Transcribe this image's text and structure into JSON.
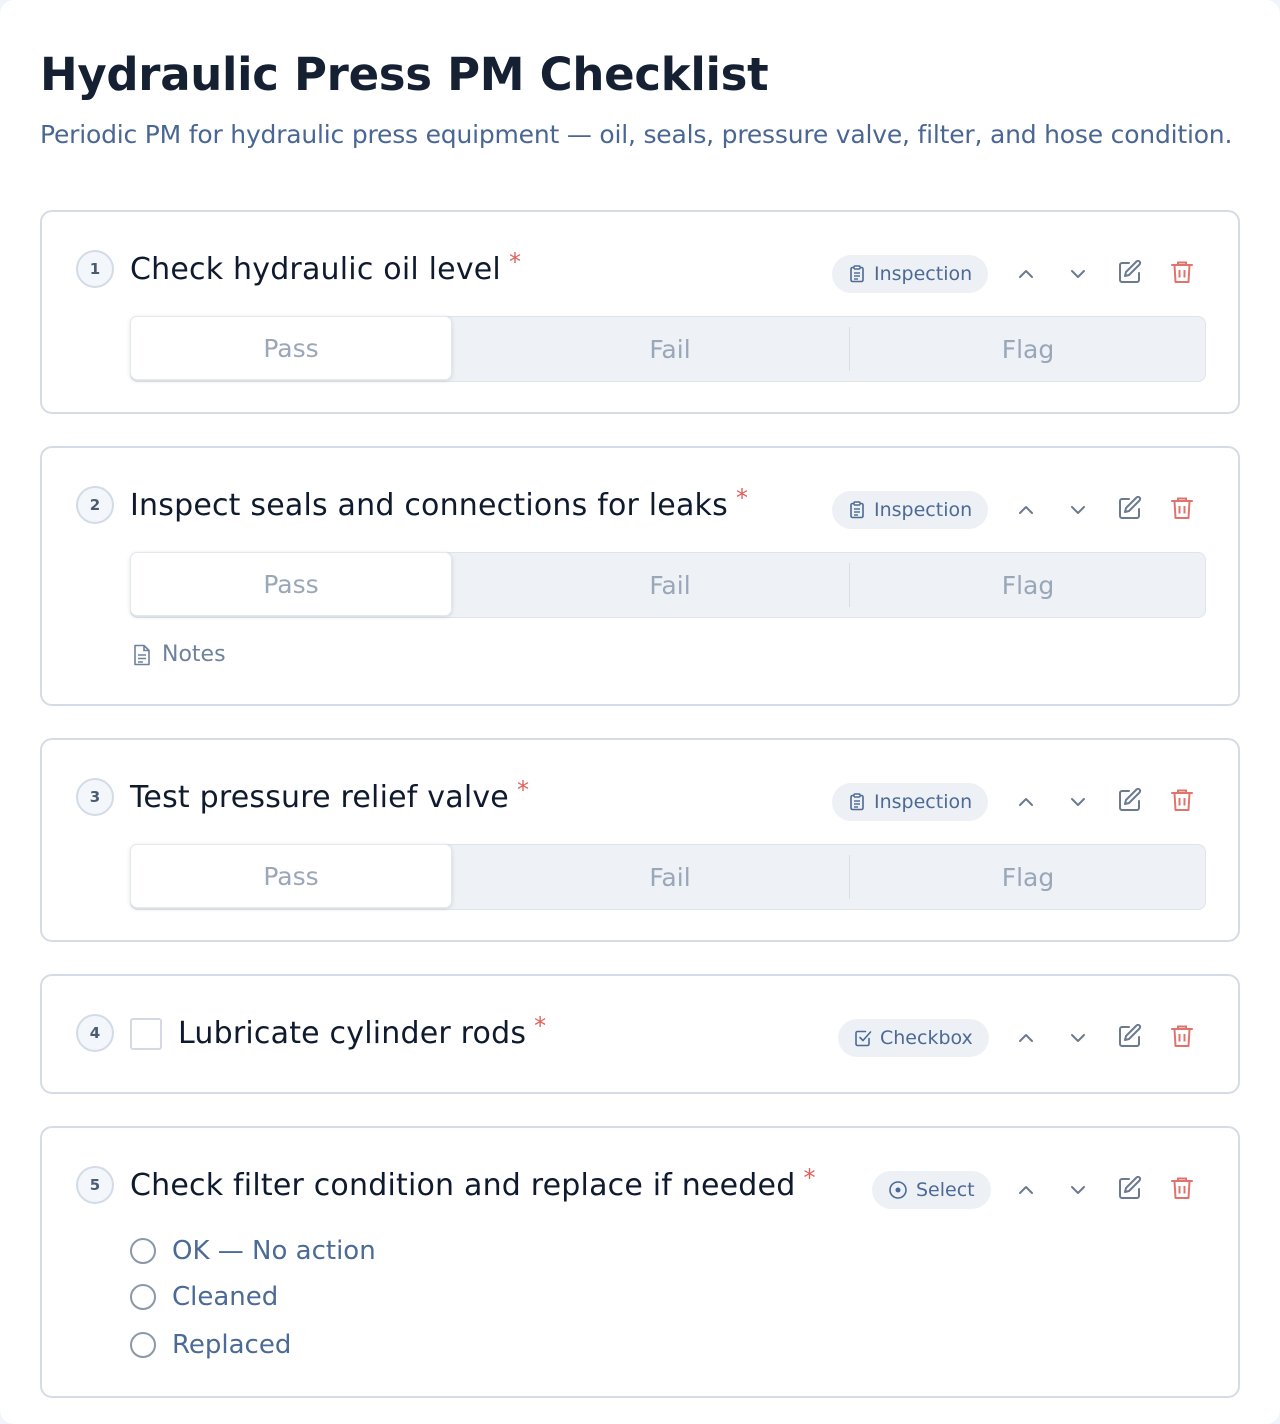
{
  "page": {
    "title": "Hydraulic Press PM Checklist",
    "subtitle": "Periodic PM for hydraulic press equipment — oil, seals, pressure valve, filter, and hose condition."
  },
  "items": [
    {
      "number": "1",
      "title": "Check hydraulic oil level",
      "required": "*",
      "type_label": "Inspection",
      "type_icon": "clipboard-icon",
      "options": [
        "Pass",
        "Fail",
        "Flag"
      ],
      "selected": "Pass"
    },
    {
      "number": "2",
      "title": "Inspect seals and connections for leaks",
      "required": "*",
      "type_label": "Inspection",
      "type_icon": "clipboard-icon",
      "options": [
        "Pass",
        "Fail",
        "Flag"
      ],
      "selected": "Pass",
      "notes_label": "Notes"
    },
    {
      "number": "3",
      "title": "Test pressure relief valve",
      "required": "*",
      "type_label": "Inspection",
      "type_icon": "clipboard-icon",
      "options": [
        "Pass",
        "Fail",
        "Flag"
      ],
      "selected": "Pass"
    },
    {
      "number": "4",
      "title": "Lubricate cylinder rods",
      "required": "*",
      "type_label": "Checkbox",
      "type_icon": "checkbox-icon",
      "checked": false
    },
    {
      "number": "5",
      "title": "Check filter condition and replace if needed",
      "required": "*",
      "type_label": "Select",
      "type_icon": "radio-select-icon",
      "choices": [
        "OK — No action",
        "Cleaned",
        "Replaced"
      ]
    }
  ],
  "colors": {
    "accent": "#4c6a95",
    "required": "#e0615b",
    "delete": "#e0746c",
    "border": "#d5dce6"
  }
}
